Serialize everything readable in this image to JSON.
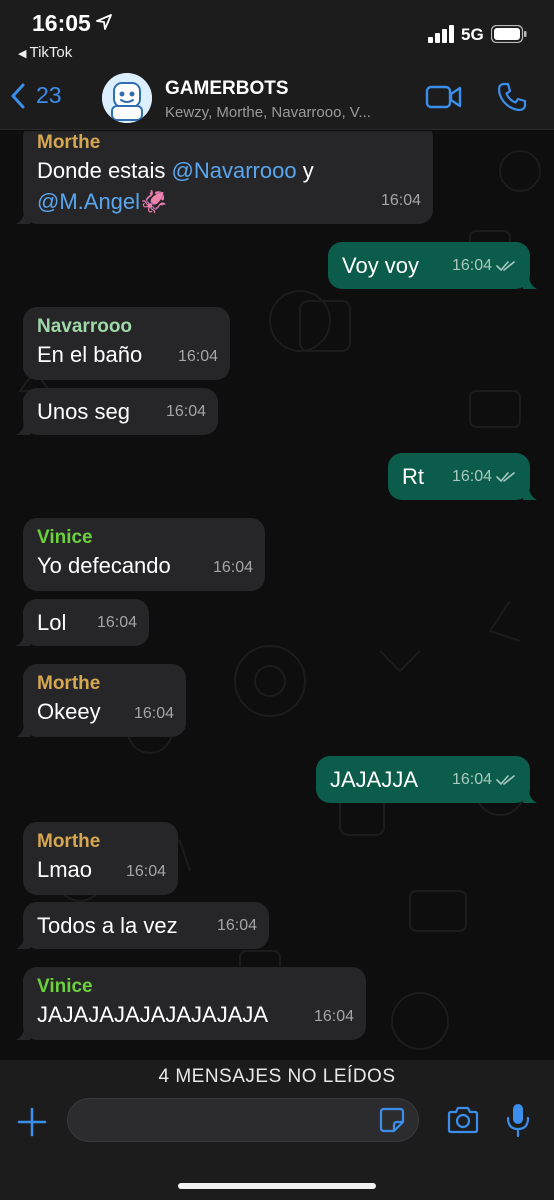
{
  "status_bar": {
    "time": "16:05",
    "back_app": "TikTok",
    "network": "5G"
  },
  "header": {
    "back_count": "23",
    "title": "GAMERBOTS",
    "subtitle": "Kewzy, Morthe, Navarrooo, V..."
  },
  "messages": [
    {
      "dir": "in",
      "sender": "Morthe",
      "line1_pre": "Donde estais ",
      "mention1": "@Navarrooo",
      "line1_post": " y",
      "mention2": "@M.Angel",
      "emoji": "🦑",
      "time": "16:04"
    },
    {
      "dir": "out",
      "text": "Voy voy",
      "time": "16:04"
    },
    {
      "dir": "in",
      "sender": "Navarrooo",
      "text": "En el baño",
      "time": "16:04"
    },
    {
      "dir": "in",
      "text": "Unos seg",
      "time": "16:04"
    },
    {
      "dir": "out",
      "text": "Rt",
      "time": "16:04"
    },
    {
      "dir": "in",
      "sender": "Vinice",
      "text": "Yo defecando",
      "time": "16:04"
    },
    {
      "dir": "in",
      "text": "Lol",
      "time": "16:04"
    },
    {
      "dir": "in",
      "sender": "Morthe",
      "text": "Okeey",
      "time": "16:04"
    },
    {
      "dir": "out",
      "text": "JAJAJJA",
      "time": "16:04"
    },
    {
      "dir": "in",
      "sender": "Morthe",
      "text": "Lmao",
      "time": "16:04"
    },
    {
      "dir": "in",
      "text": "Todos a la vez",
      "time": "16:04"
    },
    {
      "dir": "in",
      "sender": "Vinice",
      "text": "JAJAJAJAJAJAJAJAJA",
      "time": "16:04"
    }
  ],
  "unread_banner": "4 MENSAJES NO LEÍDOS",
  "input": {
    "placeholder": ""
  },
  "colors": {
    "accent": "#3b8eea",
    "outgoing_bubble": "#0b5c4a",
    "incoming_bubble": "#262628",
    "sender_morthe": "#d6a74e",
    "sender_navarrooo": "#9fd8a8",
    "sender_vinice": "#6bd03b"
  },
  "icons": [
    "location-arrow-icon",
    "signal-icon",
    "battery-icon",
    "back-chevron-icon",
    "group-avatar",
    "video-call-icon",
    "phone-icon",
    "read-ticks-icon",
    "plus-icon",
    "sticker-icon",
    "camera-icon",
    "microphone-icon"
  ]
}
